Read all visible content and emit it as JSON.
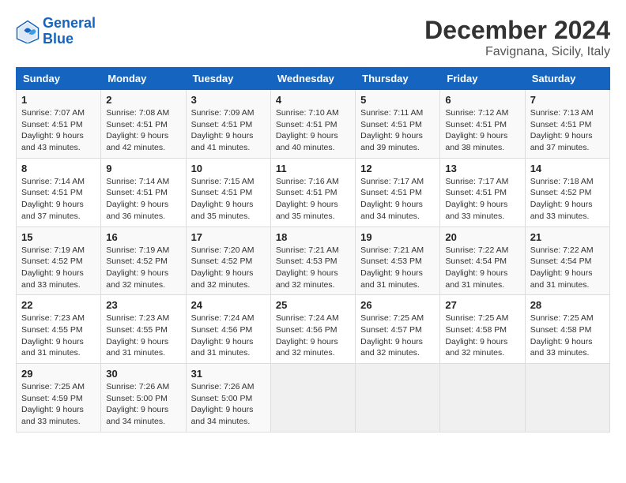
{
  "header": {
    "logo_line1": "General",
    "logo_line2": "Blue",
    "month_title": "December 2024",
    "location": "Favignana, Sicily, Italy"
  },
  "weekdays": [
    "Sunday",
    "Monday",
    "Tuesday",
    "Wednesday",
    "Thursday",
    "Friday",
    "Saturday"
  ],
  "weeks": [
    [
      {
        "day": "1",
        "sunrise": "7:07 AM",
        "sunset": "4:51 PM",
        "daylight": "9 hours and 43 minutes."
      },
      {
        "day": "2",
        "sunrise": "7:08 AM",
        "sunset": "4:51 PM",
        "daylight": "9 hours and 42 minutes."
      },
      {
        "day": "3",
        "sunrise": "7:09 AM",
        "sunset": "4:51 PM",
        "daylight": "9 hours and 41 minutes."
      },
      {
        "day": "4",
        "sunrise": "7:10 AM",
        "sunset": "4:51 PM",
        "daylight": "9 hours and 40 minutes."
      },
      {
        "day": "5",
        "sunrise": "7:11 AM",
        "sunset": "4:51 PM",
        "daylight": "9 hours and 39 minutes."
      },
      {
        "day": "6",
        "sunrise": "7:12 AM",
        "sunset": "4:51 PM",
        "daylight": "9 hours and 38 minutes."
      },
      {
        "day": "7",
        "sunrise": "7:13 AM",
        "sunset": "4:51 PM",
        "daylight": "9 hours and 37 minutes."
      }
    ],
    [
      {
        "day": "8",
        "sunrise": "7:14 AM",
        "sunset": "4:51 PM",
        "daylight": "9 hours and 37 minutes."
      },
      {
        "day": "9",
        "sunrise": "7:14 AM",
        "sunset": "4:51 PM",
        "daylight": "9 hours and 36 minutes."
      },
      {
        "day": "10",
        "sunrise": "7:15 AM",
        "sunset": "4:51 PM",
        "daylight": "9 hours and 35 minutes."
      },
      {
        "day": "11",
        "sunrise": "7:16 AM",
        "sunset": "4:51 PM",
        "daylight": "9 hours and 35 minutes."
      },
      {
        "day": "12",
        "sunrise": "7:17 AM",
        "sunset": "4:51 PM",
        "daylight": "9 hours and 34 minutes."
      },
      {
        "day": "13",
        "sunrise": "7:17 AM",
        "sunset": "4:51 PM",
        "daylight": "9 hours and 33 minutes."
      },
      {
        "day": "14",
        "sunrise": "7:18 AM",
        "sunset": "4:52 PM",
        "daylight": "9 hours and 33 minutes."
      }
    ],
    [
      {
        "day": "15",
        "sunrise": "7:19 AM",
        "sunset": "4:52 PM",
        "daylight": "9 hours and 33 minutes."
      },
      {
        "day": "16",
        "sunrise": "7:19 AM",
        "sunset": "4:52 PM",
        "daylight": "9 hours and 32 minutes."
      },
      {
        "day": "17",
        "sunrise": "7:20 AM",
        "sunset": "4:52 PM",
        "daylight": "9 hours and 32 minutes."
      },
      {
        "day": "18",
        "sunrise": "7:21 AM",
        "sunset": "4:53 PM",
        "daylight": "9 hours and 32 minutes."
      },
      {
        "day": "19",
        "sunrise": "7:21 AM",
        "sunset": "4:53 PM",
        "daylight": "9 hours and 31 minutes."
      },
      {
        "day": "20",
        "sunrise": "7:22 AM",
        "sunset": "4:54 PM",
        "daylight": "9 hours and 31 minutes."
      },
      {
        "day": "21",
        "sunrise": "7:22 AM",
        "sunset": "4:54 PM",
        "daylight": "9 hours and 31 minutes."
      }
    ],
    [
      {
        "day": "22",
        "sunrise": "7:23 AM",
        "sunset": "4:55 PM",
        "daylight": "9 hours and 31 minutes."
      },
      {
        "day": "23",
        "sunrise": "7:23 AM",
        "sunset": "4:55 PM",
        "daylight": "9 hours and 31 minutes."
      },
      {
        "day": "24",
        "sunrise": "7:24 AM",
        "sunset": "4:56 PM",
        "daylight": "9 hours and 31 minutes."
      },
      {
        "day": "25",
        "sunrise": "7:24 AM",
        "sunset": "4:56 PM",
        "daylight": "9 hours and 32 minutes."
      },
      {
        "day": "26",
        "sunrise": "7:25 AM",
        "sunset": "4:57 PM",
        "daylight": "9 hours and 32 minutes."
      },
      {
        "day": "27",
        "sunrise": "7:25 AM",
        "sunset": "4:58 PM",
        "daylight": "9 hours and 32 minutes."
      },
      {
        "day": "28",
        "sunrise": "7:25 AM",
        "sunset": "4:58 PM",
        "daylight": "9 hours and 33 minutes."
      }
    ],
    [
      {
        "day": "29",
        "sunrise": "7:25 AM",
        "sunset": "4:59 PM",
        "daylight": "9 hours and 33 minutes."
      },
      {
        "day": "30",
        "sunrise": "7:26 AM",
        "sunset": "5:00 PM",
        "daylight": "9 hours and 34 minutes."
      },
      {
        "day": "31",
        "sunrise": "7:26 AM",
        "sunset": "5:00 PM",
        "daylight": "9 hours and 34 minutes."
      },
      null,
      null,
      null,
      null
    ]
  ]
}
